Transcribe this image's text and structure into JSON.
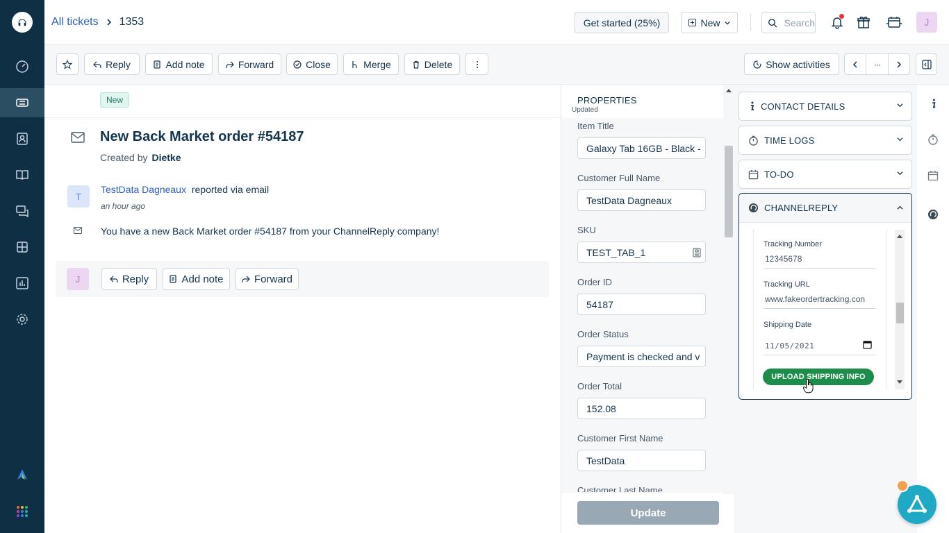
{
  "breadcrumb": {
    "parent": "All tickets",
    "ticket_id": "1353"
  },
  "header": {
    "get_started": "Get started (25%)",
    "new_label": "New",
    "search_placeholder": "Search",
    "avatar_initial": "J"
  },
  "toolbar": {
    "reply": "Reply",
    "add_note": "Add note",
    "forward": "Forward",
    "close": "Close",
    "merge": "Merge",
    "delete": "Delete",
    "show_activities": "Show activities",
    "ellipsis": "···"
  },
  "ticket": {
    "status_badge": "New",
    "subject": "New Back Market order #54187",
    "created_by_label": "Created by",
    "created_by": "Dietke",
    "reporter_initial": "T",
    "reporter": "TestData Dagneaux",
    "reported_via": "reported via email",
    "time_ago": "an hour ago",
    "message": "You have a new Back Market order #54187 from your ChannelReply company!"
  },
  "reply_bar": {
    "avatar_initial": "J",
    "reply": "Reply",
    "add_note": "Add note",
    "forward": "Forward"
  },
  "properties": {
    "title": "PROPERTIES",
    "updated": "Updated",
    "fields": [
      {
        "label": "Item Title",
        "value": "Galaxy Tab 16GB - Black -"
      },
      {
        "label": "Customer Full Name",
        "value": "TestData Dagneaux"
      },
      {
        "label": "SKU",
        "value": "TEST_TAB_1"
      },
      {
        "label": "Order ID",
        "value": "54187"
      },
      {
        "label": "Order Status",
        "value": "Payment is checked and v"
      },
      {
        "label": "Order Total",
        "value": "152.08"
      },
      {
        "label": "Customer First Name",
        "value": "TestData"
      },
      {
        "label": "Customer Last Name",
        "value": ""
      }
    ],
    "update_button": "Update"
  },
  "sidebar": {
    "contact_details": "CONTACT DETAILS",
    "time_logs": "TIME LOGS",
    "todo": "TO-DO",
    "channelreply": "CHANNELREPLY",
    "tracking_number_label": "Tracking Number",
    "tracking_number": "12345678",
    "tracking_url_label": "Tracking URL",
    "tracking_url": "www.fakeordertracking.con",
    "shipping_date_label": "Shipping Date",
    "shipping_date": "11/05/2021",
    "upload_button": "UPLOAD SHIPPING INFO"
  },
  "colors": {
    "nav_bg": "#0f2f45",
    "link": "#2c5cc5",
    "upload_green": "#1e8d4b",
    "fab": "#1fa9c4"
  }
}
